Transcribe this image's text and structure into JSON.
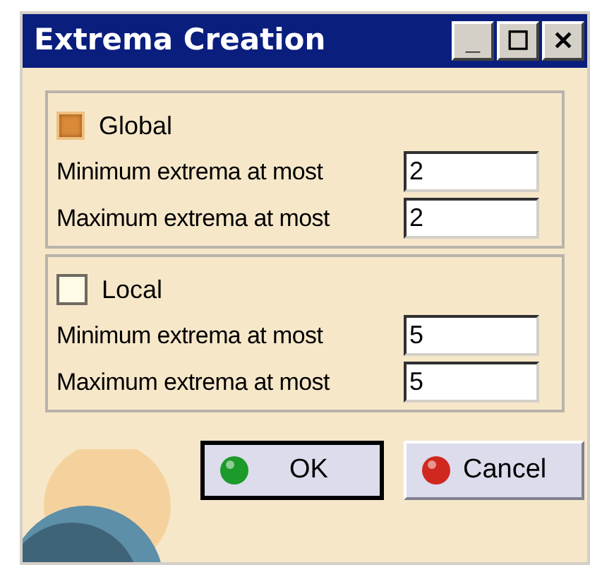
{
  "window": {
    "title": "Extrema Creation",
    "controls": [
      "_",
      "☐",
      "✕"
    ]
  },
  "groups": [
    {
      "label": "Global",
      "checked": true,
      "fields": [
        {
          "label": "Minimum extrema at most",
          "value": "2"
        },
        {
          "label": "Maximum extrema at most",
          "value": "2"
        }
      ]
    },
    {
      "label": "Local",
      "checked": false,
      "fields": [
        {
          "label": "Minimum extrema at most",
          "value": "5"
        },
        {
          "label": "Maximum extrema at most",
          "value": "5"
        }
      ]
    }
  ],
  "buttons": [
    {
      "label": "OK",
      "kind": "ok"
    },
    {
      "label": "Cancel",
      "kind": "cancel"
    }
  ]
}
